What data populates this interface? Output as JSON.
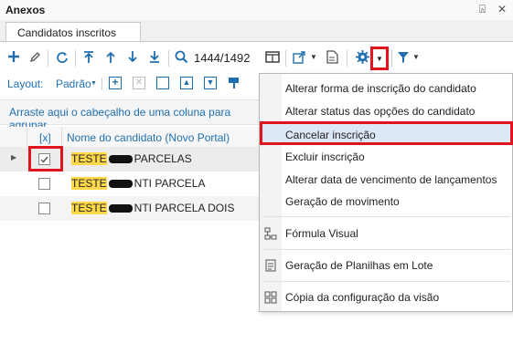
{
  "window": {
    "title": "Anexos",
    "pin_glyph": "⍓",
    "close_glyph": "✕"
  },
  "tabs": [
    {
      "label": "Candidatos inscritos"
    }
  ],
  "toolbar": {
    "record_counter": "1444/1492",
    "icons": [
      "add-icon",
      "edit-icon",
      "refresh-icon",
      "move-top-icon",
      "move-up-icon",
      "move-down-icon",
      "move-bottom-icon",
      "search-icon",
      "panel-icon",
      "export-icon",
      "document-icon",
      "gear-icon",
      "filter-icon"
    ]
  },
  "layout_bar": {
    "label": "Layout:",
    "value": "Padrão"
  },
  "group_hint": "Arraste aqui o cabeçalho de uma coluna para agrupar",
  "grid": {
    "columns": [
      {
        "label": "[x]"
      },
      {
        "label": "Nome do candidato (Novo Portal)"
      }
    ],
    "rows": [
      {
        "checked": true,
        "name_prefix": "TESTE",
        "name_suffix": "PARCELAS",
        "current": true
      },
      {
        "checked": false,
        "name_prefix": "TESTE",
        "name_suffix": "NTI PARCELA",
        "current": false
      },
      {
        "checked": false,
        "name_prefix": "TESTE",
        "name_suffix": "NTI PARCELA DOIS",
        "current": false
      }
    ]
  },
  "context_menu": {
    "items": [
      {
        "label": "Alterar forma de inscrição do candidato"
      },
      {
        "label": "Alterar status das opções do candidato"
      },
      {
        "label": "Cancelar inscrição",
        "selected": true
      },
      {
        "label": "Excluir inscrição"
      },
      {
        "label": "Alterar data de vencimento de lançamentos"
      },
      {
        "label": "Geração de movimento"
      },
      {
        "label": "Fórmula Visual",
        "icon": "formula-visual-icon"
      },
      {
        "label": "Geração de Planilhas em Lote",
        "icon": "batch-spreadsheet-icon"
      },
      {
        "label": "Cópia da configuração da visão",
        "icon": "copy-view-config-icon"
      }
    ]
  },
  "colors": {
    "accent": "#1f6fb0",
    "highlight_red": "#e0141e",
    "menu_selected": "#dce8f8",
    "name_highlight": "#ffd84a"
  }
}
